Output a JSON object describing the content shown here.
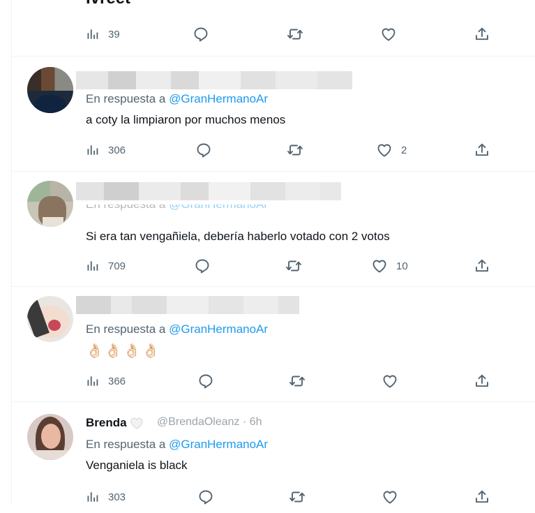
{
  "top_tweet": {
    "cut_title": "Ivreet",
    "views": "39"
  },
  "tweets": [
    {
      "reply_prefix": "En respuesta a",
      "mention": "@GranHermanoAr",
      "text": "a coty la limpiaron por muchos menos",
      "views": "306",
      "likes": "2"
    },
    {
      "reply_prefix": "En respuesta a",
      "mention": "@GranHermanoAr",
      "text": "Si era tan vengañiela, debería haberlo votado con 2 votos",
      "views": "709",
      "likes": "10"
    },
    {
      "reply_prefix": "En respuesta a",
      "mention": "@GranHermanoAr",
      "text": "👌🏻👌🏻👌🏻👌🏻",
      "views": "366",
      "likes": ""
    },
    {
      "name": "Brenda",
      "handle": "@BrendaOleanz · 6h",
      "reply_prefix": "En respuesta a",
      "mention": "@GranHermanoAr",
      "text": "Venganiela is black",
      "views": "303",
      "likes": ""
    }
  ],
  "colors": {
    "accent": "#1d9bf0",
    "muted": "#536471",
    "border": "#eff3f4"
  }
}
